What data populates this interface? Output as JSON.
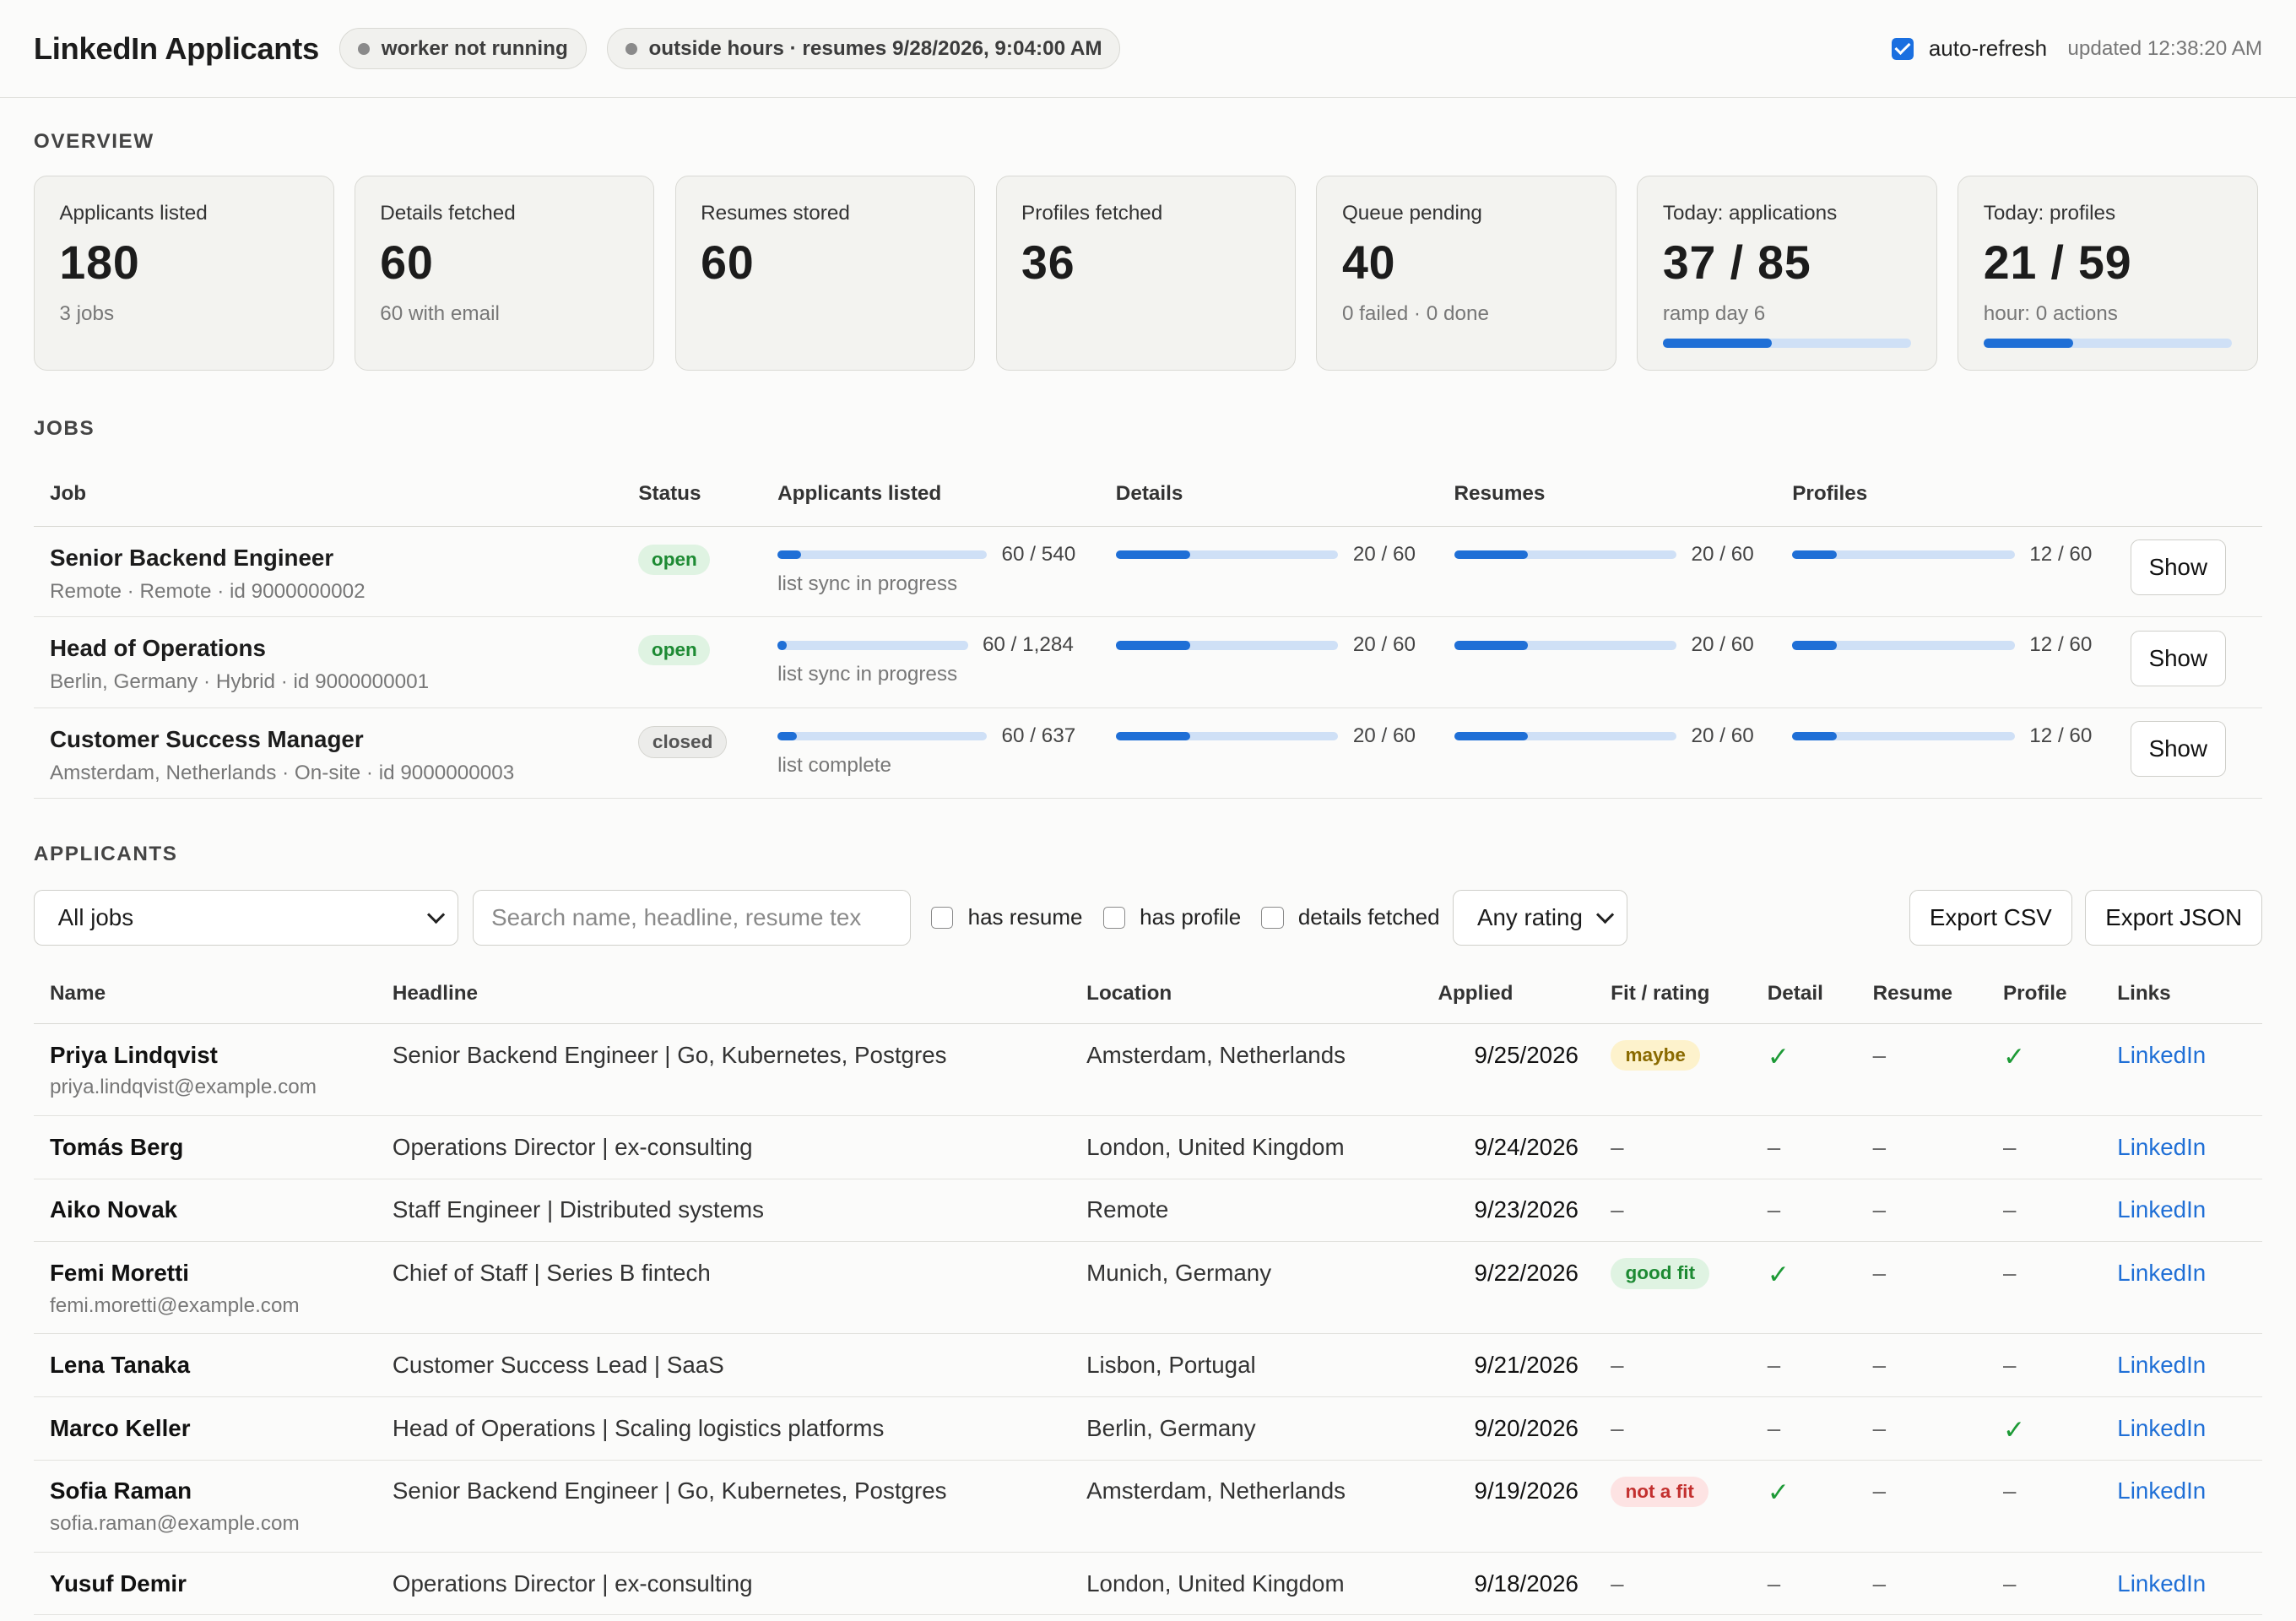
{
  "header": {
    "title": "LinkedIn Applicants",
    "worker_status": "worker not running",
    "schedule_status": "outside hours · resumes 9/28/2026, 9:04:00 AM",
    "auto_refresh_label": "auto-refresh",
    "auto_refresh_checked": true,
    "updated": "updated 12:38:20 AM"
  },
  "overview": {
    "title": "OVERVIEW",
    "cards": [
      {
        "label": "Applicants listed",
        "value": "180",
        "sub": "3 jobs"
      },
      {
        "label": "Details fetched",
        "value": "60",
        "sub": "60 with email"
      },
      {
        "label": "Resumes stored",
        "value": "60",
        "sub": ""
      },
      {
        "label": "Profiles fetched",
        "value": "36",
        "sub": ""
      },
      {
        "label": "Queue pending",
        "value": "40",
        "sub": "0 failed · 0 done"
      },
      {
        "label": "Today: applications",
        "value": "37 / 85",
        "sub": "ramp day 6",
        "progress": 0.44
      },
      {
        "label": "Today: profiles",
        "value": "21 / 59",
        "sub": "hour: 0 actions",
        "progress": 0.36
      }
    ]
  },
  "jobs": {
    "title": "JOBS",
    "columns": [
      "Job",
      "Status",
      "Applicants listed",
      "Details",
      "Resumes",
      "Profiles"
    ],
    "rows": [
      {
        "title": "Senior Backend Engineer",
        "meta": "Remote · Remote · id 9000000002",
        "status": "open",
        "listed": {
          "text": "60 / 540",
          "fraction": 0.111,
          "note": "list sync in progress"
        },
        "details": {
          "text": "20 / 60",
          "fraction": 0.333
        },
        "resumes": {
          "text": "20 / 60",
          "fraction": 0.333
        },
        "profiles": {
          "text": "12 / 60",
          "fraction": 0.2
        },
        "button": "Show"
      },
      {
        "title": "Head of Operations",
        "meta": "Berlin, Germany · Hybrid · id 9000000001",
        "status": "open",
        "listed": {
          "text": "60 / 1,284",
          "fraction": 0.047,
          "note": "list sync in progress"
        },
        "details": {
          "text": "20 / 60",
          "fraction": 0.333
        },
        "resumes": {
          "text": "20 / 60",
          "fraction": 0.333
        },
        "profiles": {
          "text": "12 / 60",
          "fraction": 0.2
        },
        "button": "Show"
      },
      {
        "title": "Customer Success Manager",
        "meta": "Amsterdam, Netherlands · On-site · id 9000000003",
        "status": "closed",
        "listed": {
          "text": "60 / 637",
          "fraction": 0.094,
          "note": "list complete"
        },
        "details": {
          "text": "20 / 60",
          "fraction": 0.333
        },
        "resumes": {
          "text": "20 / 60",
          "fraction": 0.333
        },
        "profiles": {
          "text": "12 / 60",
          "fraction": 0.2
        },
        "button": "Show"
      }
    ]
  },
  "applicants": {
    "title": "APPLICANTS",
    "filters": {
      "job_select": "All jobs",
      "search_placeholder": "Search name, headline, resume tex",
      "has_resume": "has resume",
      "has_profile": "has profile",
      "details_fetched": "details fetched",
      "rating_select": "Any rating",
      "export_csv": "Export CSV",
      "export_json": "Export JSON"
    },
    "columns": [
      "Name",
      "Headline",
      "Location",
      "Applied",
      "Fit / rating",
      "Detail",
      "Resume",
      "Profile",
      "Links"
    ],
    "rows": [
      {
        "name": "Priya Lindqvist",
        "email": "priya.lindqvist@example.com",
        "headline": "Senior Backend Engineer | Go, Kubernetes, Postgres",
        "location": "Amsterdam, Netherlands",
        "applied": "9/25/2026",
        "fit": "maybe",
        "detail": "✓",
        "resume": "–",
        "profile": "✓",
        "link": "LinkedIn"
      },
      {
        "name": "Tomás Berg",
        "email": "",
        "headline": "Operations Director | ex-consulting",
        "location": "London, United Kingdom",
        "applied": "9/24/2026",
        "fit": "–",
        "detail": "–",
        "resume": "–",
        "profile": "–",
        "link": "LinkedIn"
      },
      {
        "name": "Aiko Novak",
        "email": "",
        "headline": "Staff Engineer | Distributed systems",
        "location": "Remote",
        "applied": "9/23/2026",
        "fit": "–",
        "detail": "–",
        "resume": "–",
        "profile": "–",
        "link": "LinkedIn"
      },
      {
        "name": "Femi Moretti",
        "email": "femi.moretti@example.com",
        "headline": "Chief of Staff | Series B fintech",
        "location": "Munich, Germany",
        "applied": "9/22/2026",
        "fit": "good fit",
        "detail": "✓",
        "resume": "–",
        "profile": "–",
        "link": "LinkedIn"
      },
      {
        "name": "Lena Tanaka",
        "email": "",
        "headline": "Customer Success Lead | SaaS",
        "location": "Lisbon, Portugal",
        "applied": "9/21/2026",
        "fit": "–",
        "detail": "–",
        "resume": "–",
        "profile": "–",
        "link": "LinkedIn"
      },
      {
        "name": "Marco Keller",
        "email": "",
        "headline": "Head of Operations | Scaling logistics platforms",
        "location": "Berlin, Germany",
        "applied": "9/20/2026",
        "fit": "–",
        "detail": "–",
        "resume": "–",
        "profile": "✓",
        "link": "LinkedIn"
      },
      {
        "name": "Sofia Raman",
        "email": "sofia.raman@example.com",
        "headline": "Senior Backend Engineer | Go, Kubernetes, Postgres",
        "location": "Amsterdam, Netherlands",
        "applied": "9/19/2026",
        "fit": "not a fit",
        "detail": "✓",
        "resume": "–",
        "profile": "–",
        "link": "LinkedIn"
      },
      {
        "name": "Yusuf Demir",
        "email": "",
        "headline": "Operations Director | ex-consulting",
        "location": "London, United Kingdom",
        "applied": "9/18/2026",
        "fit": "–",
        "detail": "–",
        "resume": "–",
        "profile": "–",
        "link": "LinkedIn"
      }
    ]
  }
}
